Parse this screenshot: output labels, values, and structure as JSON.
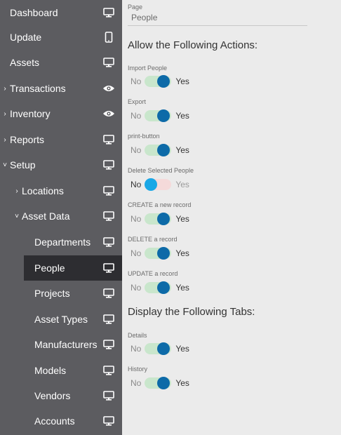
{
  "sidebar": {
    "items": [
      {
        "label": "Dashboard",
        "icon": "monitor-icon"
      },
      {
        "label": "Update",
        "icon": "mobile-icon"
      },
      {
        "label": "Assets",
        "icon": "monitor-icon"
      },
      {
        "label": "Transactions",
        "icon": "eye-icon"
      },
      {
        "label": "Inventory",
        "icon": "eye-icon"
      },
      {
        "label": "Reports",
        "icon": "monitor-icon"
      },
      {
        "label": "Setup",
        "icon": "monitor-icon"
      },
      {
        "label": "Locations",
        "icon": "monitor-icon"
      },
      {
        "label": "Asset Data",
        "icon": "monitor-icon"
      },
      {
        "label": "Departments",
        "icon": "monitor-icon"
      },
      {
        "label": "People",
        "icon": "monitor-icon"
      },
      {
        "label": "Projects",
        "icon": "monitor-icon"
      },
      {
        "label": "Asset Types",
        "icon": "monitor-icon"
      },
      {
        "label": "Manufacturers",
        "icon": "monitor-icon"
      },
      {
        "label": "Models",
        "icon": "monitor-icon"
      },
      {
        "label": "Vendors",
        "icon": "monitor-icon"
      },
      {
        "label": "Accounts",
        "icon": "monitor-icon"
      }
    ]
  },
  "main": {
    "page_label": "Page",
    "page_value": "People",
    "actions_title": "Allow the Following Actions:",
    "tabs_title": "Display the Following Tabs:",
    "no_label": "No",
    "yes_label": "Yes",
    "actions": [
      {
        "label": "Import People",
        "enabled": true
      },
      {
        "label": "Export",
        "enabled": true
      },
      {
        "label": "print-button",
        "enabled": true
      },
      {
        "label": "Delete Selected People",
        "enabled": false
      },
      {
        "label": "CREATE a new record",
        "enabled": true
      },
      {
        "label": "DELETE a record",
        "enabled": true
      },
      {
        "label": "UPDATE a record",
        "enabled": true
      }
    ],
    "tabs": [
      {
        "label": "Details",
        "enabled": true
      },
      {
        "label": "History",
        "enabled": true
      }
    ]
  },
  "colors": {
    "sidebar_bg": "#5c5c60",
    "sidebar_active": "#2d2d31",
    "toggle_on_knob": "#0d6aa8",
    "toggle_on_track": "#c9e6cc",
    "toggle_off_knob": "#1aa7e6",
    "toggle_off_track": "#f5dada"
  }
}
